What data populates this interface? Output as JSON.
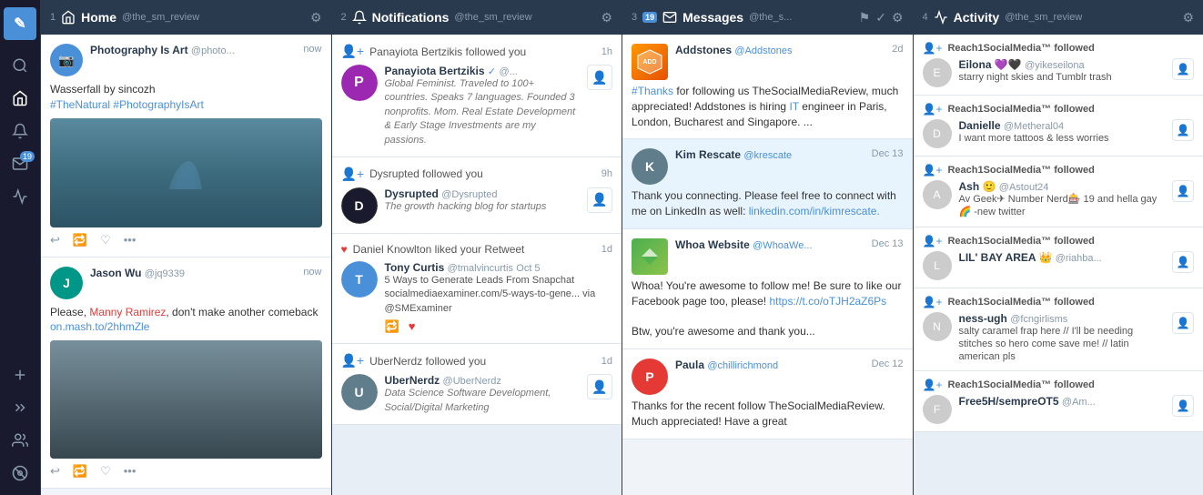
{
  "sidebar": {
    "logo": "✎",
    "items": [
      {
        "id": "search",
        "icon": "search",
        "active": false
      },
      {
        "id": "home",
        "icon": "home",
        "active": true
      },
      {
        "id": "notifications",
        "icon": "bell",
        "active": false
      },
      {
        "id": "messages",
        "icon": "mail",
        "badge": "19",
        "active": false
      },
      {
        "id": "activity",
        "icon": "pulse",
        "active": false
      },
      {
        "id": "compose",
        "icon": "plus",
        "active": false
      },
      {
        "id": "users",
        "icon": "users",
        "active": false
      },
      {
        "id": "settings",
        "icon": "gear",
        "active": false
      }
    ]
  },
  "columns": [
    {
      "id": "home",
      "number": "1",
      "title": "Home",
      "account": "@the_sm_review",
      "tweets": [
        {
          "id": "t1",
          "name": "Photography Is Art",
          "handle": "@photo...",
          "time": "now",
          "text": "Wasserfall by sincozh\n#TheNatural #PhotographyIsArt",
          "has_image": true,
          "image_type": "waterfall",
          "actions": [
            "reply",
            "retweet",
            "like",
            "more"
          ]
        },
        {
          "id": "t2",
          "name": "Jason Wu",
          "handle": "@jq9339",
          "time": "now",
          "text": "Please, Manny Ramirez, don't make another comeback on.mash.to/2hhmZle",
          "has_image": true,
          "image_type": "person",
          "actions": [
            "reply",
            "retweet",
            "like",
            "more"
          ]
        }
      ]
    },
    {
      "id": "notifications",
      "number": "2",
      "title": "Notifications",
      "account": "@the_sm_review",
      "items": [
        {
          "id": "n1",
          "action": "Panayiota Bertzikis followed you",
          "time": "1h",
          "name": "Panayiota Bertzikis",
          "verified": true,
          "handle": "@...",
          "bio": "Global Feminist. Traveled to 100+ countries. Speaks 7 languages. Founded 3 nonprofits. Mom. Real Estate Development & Early Stage Investments are my passions.",
          "avatar_color": "purple"
        },
        {
          "id": "n2",
          "action": "Dysrupted followed you",
          "time": "9h",
          "name": "Dysrupted",
          "handle": "@Dysrupted",
          "bio": "The growth hacking blog for startups",
          "avatar_color": "dark",
          "avatar_text": "D"
        },
        {
          "id": "n3",
          "action": "Daniel Knowlton liked your Retweet",
          "time": "1d",
          "like_icon": true,
          "name": "Tony Curtis",
          "handle": "@tmalvincurtis",
          "date": "Oct 5",
          "text": "5 Ways to Generate Leads From Snapchat socialmediaexaminer.com/5-ways-to-gene... via @SMExaminer",
          "has_actions": true,
          "avatar_color": "blue"
        },
        {
          "id": "n4",
          "action": "UberNerdz followed you",
          "time": "1d",
          "name": "UberNerdz",
          "handle": "@UberNerdz",
          "bio": "Data Science Software Development, Social/Digital Marketing",
          "avatar_color": "gray"
        }
      ]
    },
    {
      "id": "messages",
      "number": "3",
      "title": "Messages",
      "account": "@the_s...",
      "badge": "19",
      "messages": [
        {
          "id": "m1",
          "name": "Addstones",
          "handle": "@Addstones",
          "time": "2d",
          "text": "#Thanks for following us TheSocialMediaReview, much appreciated! Addstones is hiring IT engineer in Paris, London, Bucharest and Singapore. ...",
          "avatar_type": "addstones",
          "highlighted": false
        },
        {
          "id": "m2",
          "name": "Kim Rescate",
          "handle": "@krescate",
          "time": "Dec 13",
          "text": "Thank you connecting. Please feel free to connect with me on LinkedIn as well: linkedin.com/in/kimrescate.",
          "avatar_color": "gray",
          "highlighted": true
        },
        {
          "id": "m3",
          "name": "Whoa Website",
          "handle": "@WhoaWe...",
          "time": "Dec 13",
          "text": "Whoa! You're awesome to follow me! Be sure to like our Facebook page too, please! https://t.co/oTJH2aZ6Ps\n\nBtw, you're awesome and thank you...",
          "avatar_color": "green",
          "highlighted": false
        },
        {
          "id": "m4",
          "name": "Paula",
          "handle": "@chillirichmond",
          "time": "Dec 12",
          "text": "Thanks for the recent follow TheSocialMediaReview. Much appreciated! Have a great",
          "avatar_color": "red",
          "highlighted": false
        }
      ]
    },
    {
      "id": "activity",
      "number": "4",
      "title": "Activity",
      "account": "@the_sm_review",
      "items": [
        {
          "id": "a1",
          "action": "Reach1SocialMedia™ followed",
          "name": "Eilona 💜🖤",
          "handle": "@yikeseilona",
          "text": "starry night skies and Tumblr trash",
          "avatar_color": "purple",
          "avatar_text": "E"
        },
        {
          "id": "a2",
          "action": "Reach1SocialMedia™ followed",
          "name": "Danielle",
          "handle": "@Metheral04",
          "text": "I want more tattoos & less worries",
          "avatar_color": "blue",
          "avatar_text": "D"
        },
        {
          "id": "a3",
          "action": "Reach1SocialMedia™ followed",
          "name": "Ash 🙂",
          "handle": "@Astout24",
          "text": "Av Geek✈ Number Nerd🎰 19 and hella gay🌈 -new twitter",
          "avatar_color": "teal",
          "avatar_text": "A"
        },
        {
          "id": "a4",
          "action": "Reach1SocialMedia™ followed",
          "name": "LIL' BAY AREA 👑",
          "handle": "@riahba...",
          "text": "",
          "avatar_color": "orange",
          "avatar_text": "L"
        },
        {
          "id": "a5",
          "action": "Reach1SocialMedia™ followed",
          "name": "ness-ugh",
          "handle": "@fcngirlisms",
          "text": "salty caramel frap here // I'll be needing stitches so hero come save me! // latin american pls",
          "avatar_color": "red",
          "avatar_text": "N"
        },
        {
          "id": "a6",
          "action": "Reach1SocialMedia™ followed",
          "name": "Free5H/sempreOT5",
          "handle": "@Am...",
          "text": "",
          "avatar_color": "gray",
          "avatar_text": "F"
        }
      ]
    }
  ]
}
